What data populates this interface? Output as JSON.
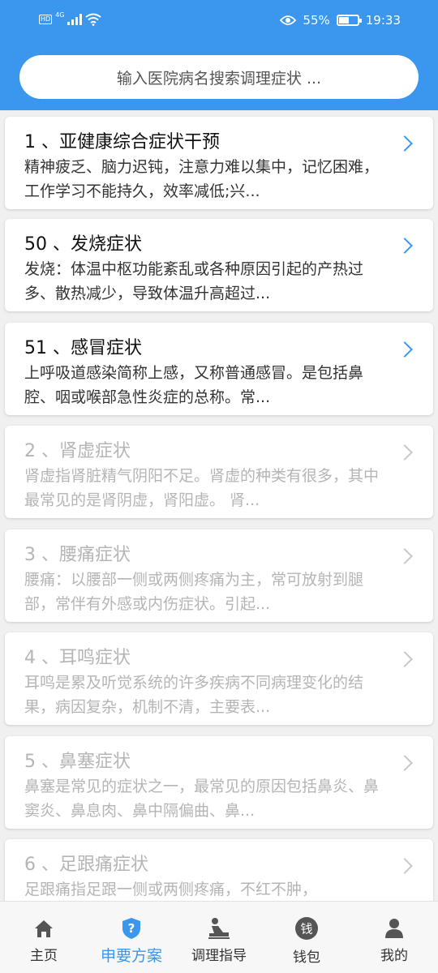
{
  "status_bar": {
    "hd": "HD",
    "network": "4G",
    "battery_percent": "55%",
    "battery_level": 0.55,
    "time": "19:33",
    "icons": [
      "signal-icon",
      "wifi-icon",
      "eye-icon",
      "battery-icon"
    ]
  },
  "search": {
    "placeholder": "输入医院病名搜索调理症状 ..."
  },
  "items": [
    {
      "title": "1 、亚健康综合症状干预",
      "desc": "精神疲乏、脑力迟钝，注意力难以集中，记忆困难，工作学习不能持久，效率减低;兴...",
      "enabled": true
    },
    {
      "title": "50 、发烧症状",
      "desc": "发烧：体温中枢功能紊乱或各种原因引起的产热过多、散热减少，导致体温升高超过...",
      "enabled": true
    },
    {
      "title": "51 、感冒症状",
      "desc": "上呼吸道感染简称上感，又称普通感冒。是包括鼻腔、咽或喉部急性炎症的总称。常...",
      "enabled": true
    },
    {
      "title": "2 、肾虚症状",
      "desc": "肾虚指肾脏精气阴阳不足。肾虚的种类有很多，其中最常见的是肾阴虚，肾阳虚。 肾...",
      "enabled": false
    },
    {
      "title": "3 、腰痛症状",
      "desc": "腰痛：以腰部一侧或两侧疼痛为主，常可放射到腿部，常伴有外感或内伤症状。引起...",
      "enabled": false
    },
    {
      "title": "4 、耳鸣症状",
      "desc": "耳鸣是累及听觉系统的许多疾病不同病理变化的结果，病因复杂，机制不清，主要表...",
      "enabled": false
    },
    {
      "title": "5 、鼻塞症状",
      "desc": "鼻塞是常见的症状之一，最常见的原因包括鼻炎、鼻窦炎、鼻息肉、鼻中隔偏曲、鼻...",
      "enabled": false
    },
    {
      "title": "6 、足跟痛症状",
      "desc": "足跟痛指足跟一侧或两侧疼痛，不红不肿，",
      "enabled": false
    }
  ],
  "tabs": [
    {
      "label": "主页",
      "icon": "home-icon",
      "active": false
    },
    {
      "label": "申要方案",
      "icon": "question-shield-icon",
      "active": true
    },
    {
      "label": "调理指导",
      "icon": "massage-icon",
      "active": false
    },
    {
      "label": "钱包",
      "icon": "wallet-icon",
      "icon_text": "钱",
      "active": false
    },
    {
      "label": "我的",
      "icon": "person-icon",
      "active": false
    }
  ],
  "colors": {
    "accent": "#3a97ed",
    "header_bg": "#3a97ed",
    "text": "#111111",
    "disabled_text": "#b5b5b5"
  }
}
